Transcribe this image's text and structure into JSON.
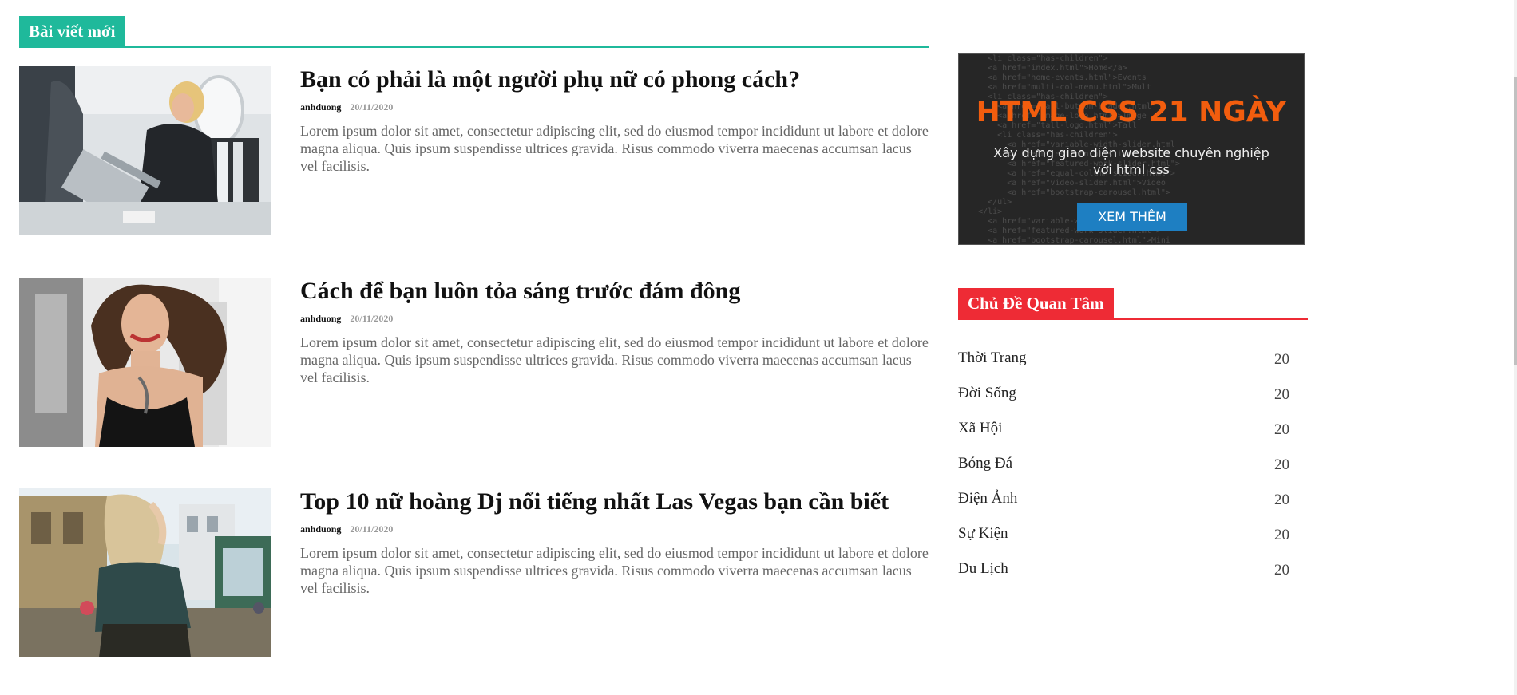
{
  "main": {
    "section_title": "Bài viết mới",
    "posts": [
      {
        "title": "Bạn có phải là một người phụ nữ có phong cách?",
        "author": "anhduong",
        "date": "20/11/2020",
        "excerpt": "Lorem ipsum dolor sit amet, consectetur adipiscing elit, sed do eiusmod tempor incididunt ut labore et dolore magna aliqua. Quis ipsum suspendisse ultrices gravida. Risus commodo viverra maecenas accumsan lacus vel facilisis."
      },
      {
        "title": "Cách để bạn luôn tỏa sáng trước đám đông",
        "author": "anhduong",
        "date": "20/11/2020",
        "excerpt": "Lorem ipsum dolor sit amet, consectetur adipiscing elit, sed do eiusmod tempor incididunt ut labore et dolore magna aliqua. Quis ipsum suspendisse ultrices gravida. Risus commodo viverra maecenas accumsan lacus vel facilisis."
      },
      {
        "title": "Top 10 nữ hoàng Dj nổi tiếng nhất Las Vegas bạn cần biết",
        "author": "anhduong",
        "date": "20/11/2020",
        "excerpt": "Lorem ipsum dolor sit amet, consectetur adipiscing elit, sed do eiusmod tempor incididunt ut labore et dolore magna aliqua. Quis ipsum suspendisse ultrices gravida. Risus commodo viverra maecenas accumsan lacus vel facilisis."
      }
    ]
  },
  "sidebar": {
    "banner": {
      "title": "HTML CSS 21 NGÀY",
      "subtitle": "Xây dựng giao diện website chuyên nghiệp với html css",
      "button": "XEM THÊM"
    },
    "topics_title": "Chủ Đề Quan Tâm",
    "topics": [
      {
        "name": "Thời Trang",
        "count": "20"
      },
      {
        "name": "Đời Sống",
        "count": "20"
      },
      {
        "name": "Xã Hội",
        "count": "20"
      },
      {
        "name": "Bóng Đá",
        "count": "20"
      },
      {
        "name": "Điện Ảnh",
        "count": "20"
      },
      {
        "name": "Sự Kiện",
        "count": "20"
      },
      {
        "name": "Du Lịch",
        "count": "20"
      }
    ]
  },
  "colors": {
    "section_accent": "#1fb99b",
    "sidebar_accent": "#ee2b35",
    "banner_title": "#f25d0e",
    "banner_button": "#1e7fc2"
  }
}
